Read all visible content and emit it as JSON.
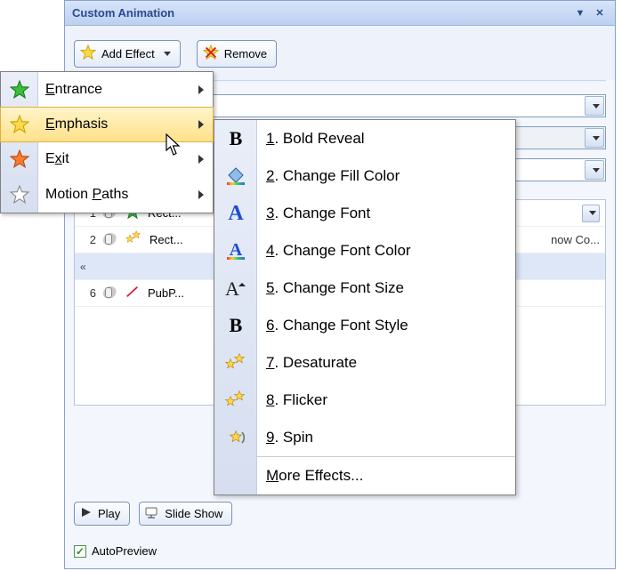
{
  "titlebar": {
    "title": "Custom Animation"
  },
  "toolbar": {
    "add_effect": "Add Effect",
    "remove": "Remove"
  },
  "menu1": {
    "entrance": "Entrance",
    "emphasis": "Emphasis",
    "exit": "Exit",
    "motion_paths": "Motion Paths"
  },
  "menu2": {
    "items": [
      {
        "n": "1",
        "label": "Bold Reveal"
      },
      {
        "n": "2",
        "label": "Change Fill Color"
      },
      {
        "n": "3",
        "label": "Change Font"
      },
      {
        "n": "4",
        "label": "Change Font Color"
      },
      {
        "n": "5",
        "label": "Change Font Size"
      },
      {
        "n": "6",
        "label": "Change Font Style"
      },
      {
        "n": "7",
        "label": "Desaturate"
      },
      {
        "n": "8",
        "label": "Flicker"
      },
      {
        "n": "9",
        "label": "Spin"
      }
    ],
    "more_key": "M",
    "more_rest": "ore Effects..."
  },
  "effect_list": {
    "r1": {
      "num": "1",
      "text": "Rect..."
    },
    "r2": {
      "num": "2",
      "text": "Rect..."
    },
    "r3": {
      "num": "6",
      "text": "PubP..."
    },
    "tail": "now Co..."
  },
  "bottom": {
    "play": "Play",
    "slideshow": "Slide Show"
  },
  "autopreview": "AutoPreview"
}
